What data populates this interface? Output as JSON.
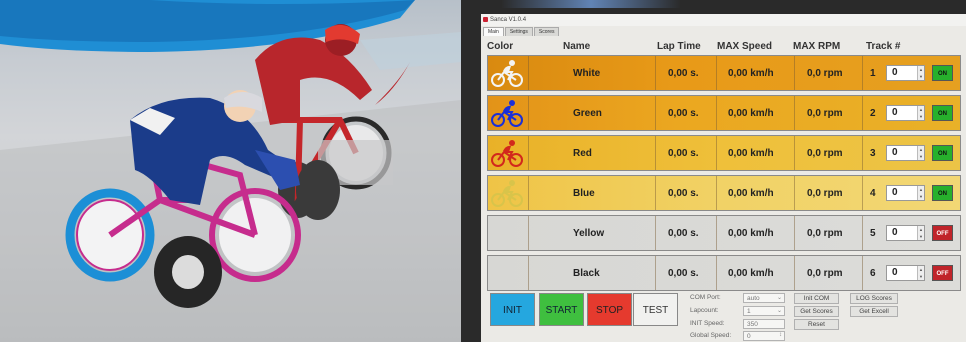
{
  "window": {
    "title": "Sanca V1.0.4",
    "tabs": [
      "Main",
      "Settings",
      "Scores"
    ]
  },
  "columns": {
    "color": "Color",
    "name": "Name",
    "lap": "Lap Time",
    "speed": "MAX Speed",
    "rpm": "MAX RPM",
    "track": "Track #"
  },
  "racers": [
    {
      "name": "White",
      "lap": "0,00 s.",
      "speed": "0,00 km/h",
      "rpm": "0,0 rpm",
      "track": "1",
      "value": "0",
      "toggle": "ON",
      "icon_color": "#f4f4f4"
    },
    {
      "name": "Green",
      "lap": "0,00 s.",
      "speed": "0,00 km/h",
      "rpm": "0,0 rpm",
      "track": "2",
      "value": "0",
      "toggle": "ON",
      "icon_color": "#1a2fd8"
    },
    {
      "name": "Red",
      "lap": "0,00 s.",
      "speed": "0,00 km/h",
      "rpm": "0,0 rpm",
      "track": "3",
      "value": "0",
      "toggle": "ON",
      "icon_color": "#d2281c"
    },
    {
      "name": "Blue",
      "lap": "0,00 s.",
      "speed": "0,00 km/h",
      "rpm": "0,0 rpm",
      "track": "4",
      "value": "0",
      "toggle": "ON",
      "icon_color": "#d8c44a"
    },
    {
      "name": "Yellow",
      "lap": "0,00 s.",
      "speed": "0,00 km/h",
      "rpm": "0,0 rpm",
      "track": "5",
      "value": "0",
      "toggle": "OFF",
      "icon_color": ""
    },
    {
      "name": "Black",
      "lap": "0,00 s.",
      "speed": "0,00 km/h",
      "rpm": "0,0 rpm",
      "track": "6",
      "value": "0",
      "toggle": "OFF",
      "icon_color": ""
    }
  ],
  "controls": {
    "init": "INIT",
    "start": "START",
    "stop": "STOP",
    "test": "TEST",
    "com_port_label": "COM Port:",
    "com_port_value": "auto",
    "lapcount_label": "Lapcount:",
    "lapcount_value": "1",
    "init_speed_label": "INIT Speed:",
    "init_speed_value": "350",
    "global_speed_label": "Global Speed:",
    "global_speed_value": "0",
    "init_com": "Init COM",
    "get_scores": "Get Scores",
    "reset": "Reset",
    "log_scores": "LOG Scores",
    "get_excel": "Get Excell"
  },
  "colors": {
    "init": "#25a7df",
    "start": "#3fbf3f",
    "stop": "#e53a2e",
    "test": "#f1f1ef",
    "on": "#27b02c",
    "off": "#c0242a"
  }
}
